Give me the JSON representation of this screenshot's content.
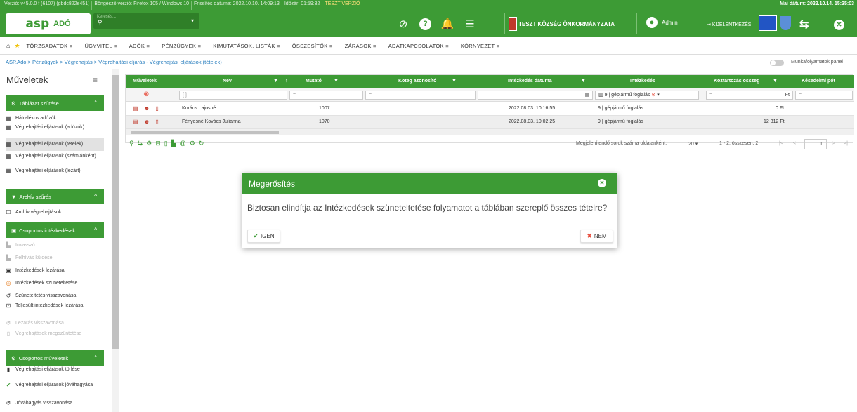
{
  "topbar": {
    "version_items": [
      "Verzió: v45.0.0 f (6107) (gbdc822e451)",
      "Böngésző verzió: Firefox 105 / Windows 10",
      "Frissítés dátuma: 2022.10.10. 14:09:13",
      "Időzár: 01:59:32"
    ],
    "test_badge": "TESZT VERZIÓ",
    "date": "Mai dátum: 2022.10.14. 15:35:03",
    "logo_asp": "asp",
    "logo_ado": "ADÓ",
    "search_placeholder": "Keresés...",
    "org": "TESZT KÖZSÉG ÖNKORMÁNYZATA",
    "user": "Admin",
    "logout": "KIJELENTKEZÉS"
  },
  "menu": [
    "TÖRZSADATOK ≡",
    "ÜGYVITEL ≡",
    "ADÓK ≡",
    "PÉNZÜGYEK ≡",
    "KIMUTATÁSOK, LISTÁK ≡",
    "ÖSSZESÍTŐK ≡",
    "ZÁRÁSOK ≡",
    "ADATKAPCSOLATOK ≡",
    "KÖRNYEZET ≡"
  ],
  "breadcrumb": "ASP.Adó  >  Pénzügyek  >  Végrehajtás  >  Végrehajtási eljárás - Végrehajtási eljárások (tételek)",
  "panel_toggle": "Munkafolyamatok panel",
  "sidebar": {
    "title": "Műveletek",
    "groups": [
      "Táblázat szűrése",
      "Archív szűrés",
      "Csoportos intézkedések",
      "Csoportos műveletek"
    ],
    "filter_items": [
      "Hátralékos adózók",
      "Végrehajtási eljárások (adózók)",
      "Végrehajtási eljárások (tételek)",
      "Végrehajtási eljárások (számlánként)",
      "Végrehajtási eljárások (lezárt)"
    ],
    "archive_item": "Archív végrehajtások",
    "action_items": [
      "Inkasszó",
      "Felhívás küldése",
      "Intézkedések lezárása",
      "Intézkedések szüneteltetése",
      "Szüneteltetés visszavonása",
      "Teljesült intézkedések lezárása",
      "Lezárás visszavonása",
      "Végrehajtások megszüntetése"
    ],
    "op_items": [
      "Végrehajtási eljárások törlése",
      "Végrehajtási eljárások jóváhagyása",
      "Jóváhagyás visszavonása"
    ]
  },
  "grid": {
    "headers": [
      "Műveletek",
      "Név",
      "Mutató",
      "Köteg azonosító",
      "Intézkedés dátuma",
      "Intézkedés",
      "Köztartozás összeg",
      "Késedelmi pót"
    ],
    "filters": {
      "intezkedes": "9 | gépjármű foglalás",
      "eq": "=",
      "ft": "Ft"
    },
    "rows": [
      {
        "name": "Korács Lajosné",
        "mutato": "1007",
        "datum": "2022.08.03. 10:16:55",
        "intezkedes": "9 | gépjármű foglalás",
        "osszeg": "0 Ft"
      },
      {
        "name": "Fényesné Kovács Julianna",
        "mutato": "1070",
        "datum": "2022.08.03. 10:02:25",
        "intezkedes": "9 | gépjármű foglalás",
        "osszeg": "12 312 Ft"
      }
    ],
    "pager_label": "Megjelenítendő sorok száma oldalanként:",
    "page_size": "20",
    "count": "1 - 2, összesen: 2",
    "page": "1"
  },
  "modal": {
    "title": "Megerősítés",
    "body": "Biztosan elindítja az Intézkedések szüneteltetése folyamatot a táblában szereplő összes tételre?",
    "yes": "IGEN",
    "no": "NEM"
  }
}
